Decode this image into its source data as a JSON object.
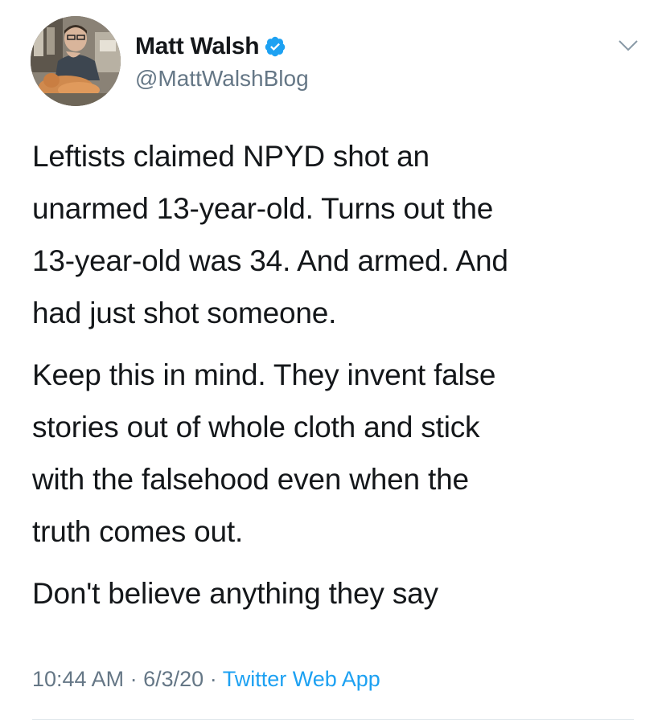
{
  "user": {
    "display_name": "Matt Walsh",
    "handle": "@MattWalshBlog",
    "verified": true
  },
  "tweet": {
    "paragraphs": [
      "Leftists claimed NPYD shot an\nunarmed 13-year-old. Turns out the\n13-year-old was 34. And armed. And\nhad just shot someone.",
      "Keep this in mind. They invent false\nstories out of whole cloth and stick\nwith the falsehood even when the\ntruth comes out.",
      "Don't believe anything they say"
    ],
    "time": "10:44 AM",
    "separator": "·",
    "date": "6/3/20",
    "source": "Twitter Web App"
  },
  "colors": {
    "text": "#14171a",
    "secondary": "#657786",
    "accent": "#1da1f2",
    "divider": "#e1e8ed"
  },
  "icons": {
    "verified": "verified-badge-icon",
    "menu": "chevron-down-icon"
  }
}
